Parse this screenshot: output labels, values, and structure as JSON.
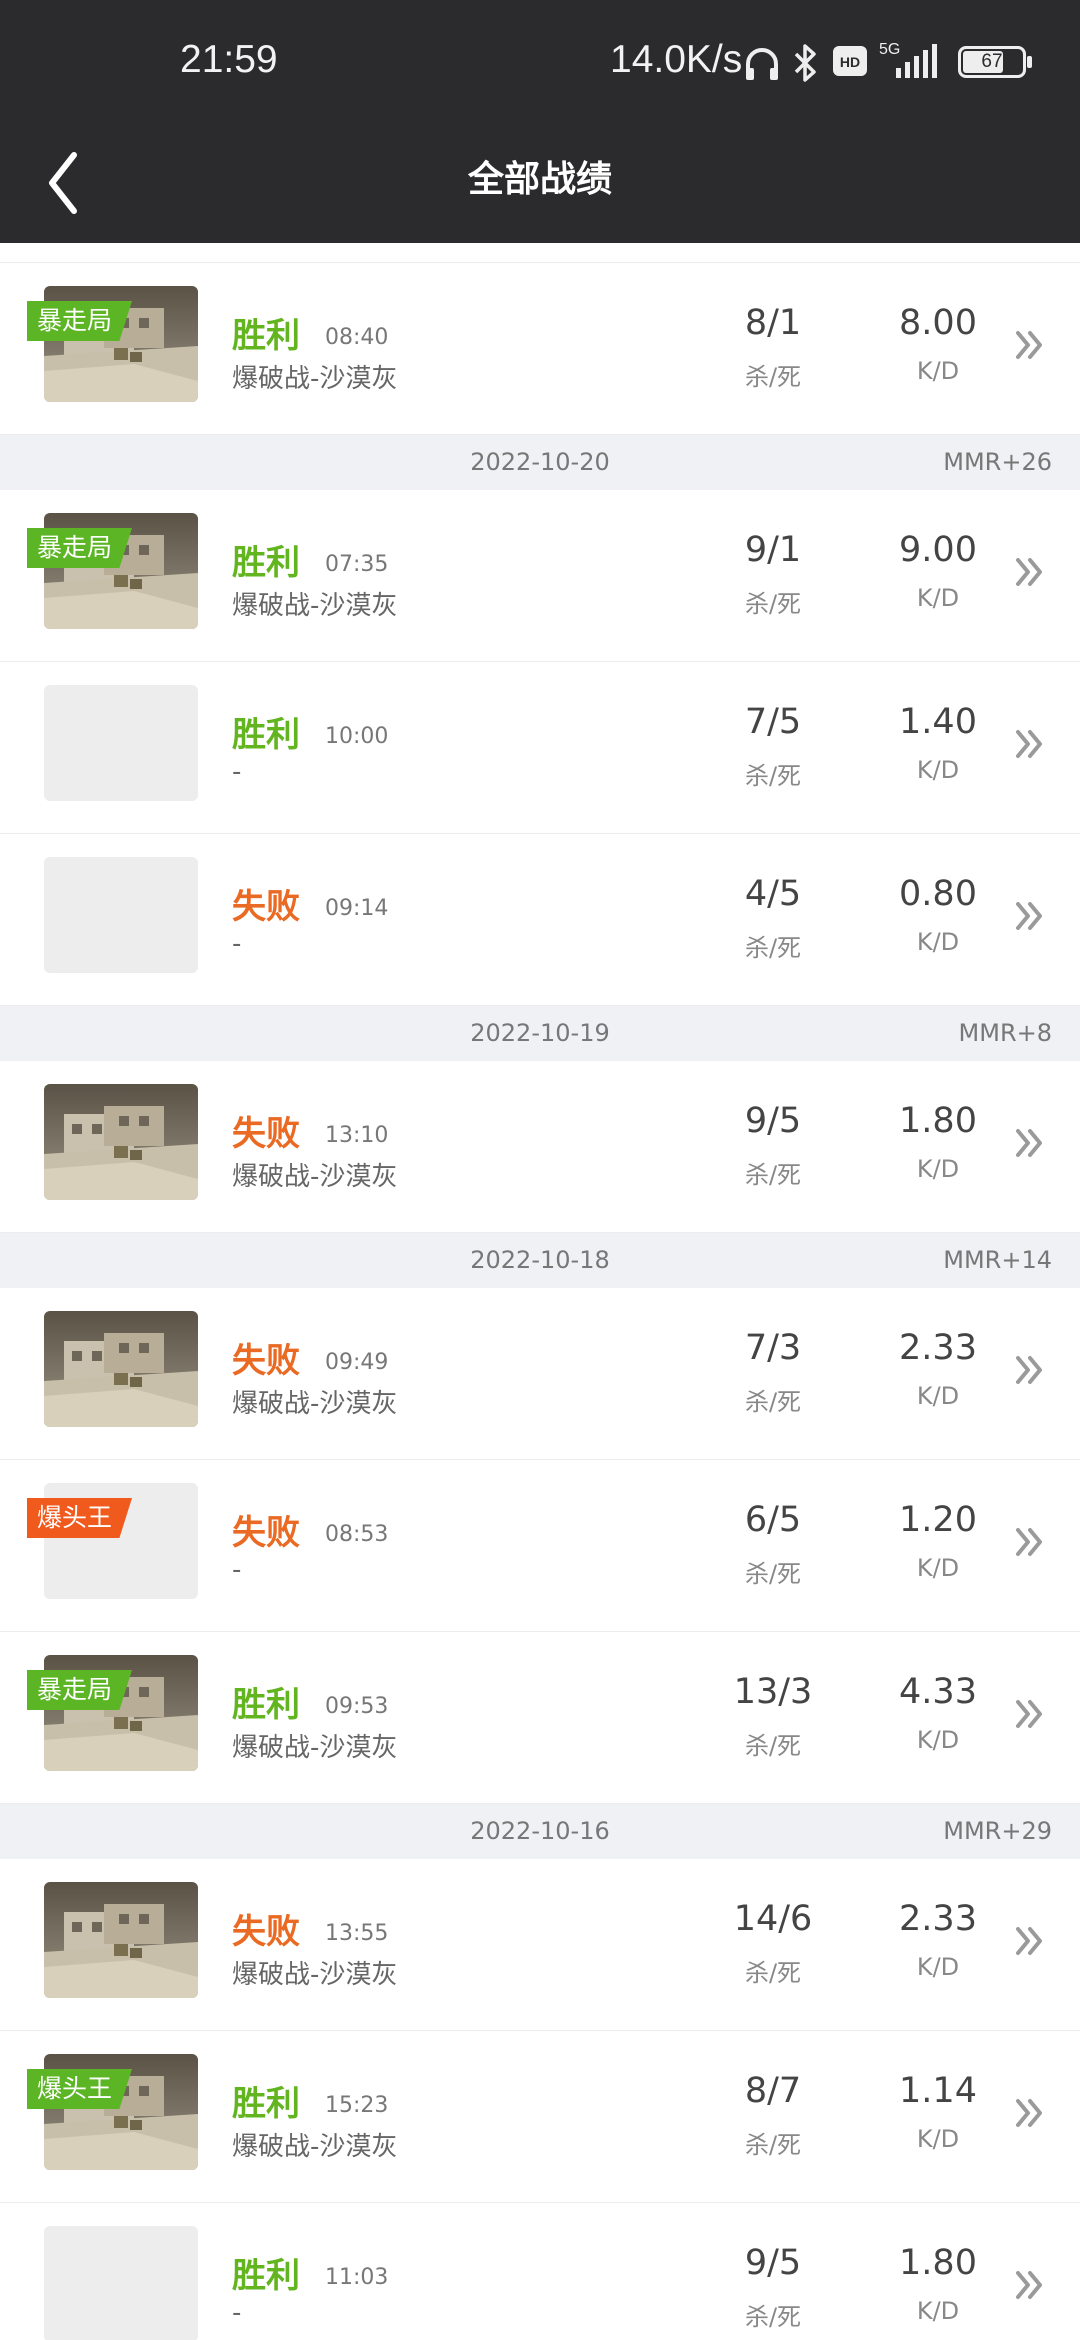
{
  "status_bar": {
    "time": "21:59",
    "network": "14.0K/s",
    "battery": "67",
    "icons": [
      "headphones-icon",
      "bluetooth-icon",
      "hd-icon",
      "signal-5g-icon",
      "battery-icon"
    ]
  },
  "header": {
    "title": "全部战绩",
    "back_icon": "back-arrow-icon"
  },
  "labels": {
    "kd_label": "杀/死",
    "ratio_label": "K/D"
  },
  "colors": {
    "win": "#62b51f",
    "lose": "#ea6a23",
    "badge_green": "#5cb525",
    "badge_orange": "#f05a1d",
    "header_bg": "#2b2b2d"
  },
  "items": [
    {
      "type": "match",
      "result": "胜利",
      "outcome": "win",
      "time": "08:40",
      "mode": "爆破战-沙漠灰",
      "kills": "8/1",
      "kd": "8.00",
      "map": true,
      "badge": "暴走局",
      "badge_color": "green"
    },
    {
      "type": "date",
      "date": "2022-10-20",
      "mmr": "MMR+26"
    },
    {
      "type": "match",
      "result": "胜利",
      "outcome": "win",
      "time": "07:35",
      "mode": "爆破战-沙漠灰",
      "kills": "9/1",
      "kd": "9.00",
      "map": true,
      "badge": "暴走局",
      "badge_color": "green"
    },
    {
      "type": "match",
      "result": "胜利",
      "outcome": "win",
      "time": "10:00",
      "mode": "-",
      "kills": "7/5",
      "kd": "1.40",
      "map": false,
      "badge": ""
    },
    {
      "type": "match",
      "result": "失败",
      "outcome": "lose",
      "time": "09:14",
      "mode": "-",
      "kills": "4/5",
      "kd": "0.80",
      "map": false,
      "badge": ""
    },
    {
      "type": "date",
      "date": "2022-10-19",
      "mmr": "MMR+8"
    },
    {
      "type": "match",
      "result": "失败",
      "outcome": "lose",
      "time": "13:10",
      "mode": "爆破战-沙漠灰",
      "kills": "9/5",
      "kd": "1.80",
      "map": true,
      "badge": ""
    },
    {
      "type": "date",
      "date": "2022-10-18",
      "mmr": "MMR+14"
    },
    {
      "type": "match",
      "result": "失败",
      "outcome": "lose",
      "time": "09:49",
      "mode": "爆破战-沙漠灰",
      "kills": "7/3",
      "kd": "2.33",
      "map": true,
      "badge": ""
    },
    {
      "type": "match",
      "result": "失败",
      "outcome": "lose",
      "time": "08:53",
      "mode": "-",
      "kills": "6/5",
      "kd": "1.20",
      "map": false,
      "badge": "爆头王",
      "badge_color": "orange"
    },
    {
      "type": "match",
      "result": "胜利",
      "outcome": "win",
      "time": "09:53",
      "mode": "爆破战-沙漠灰",
      "kills": "13/3",
      "kd": "4.33",
      "map": true,
      "badge": "暴走局",
      "badge_color": "green"
    },
    {
      "type": "date",
      "date": "2022-10-16",
      "mmr": "MMR+29"
    },
    {
      "type": "match",
      "result": "失败",
      "outcome": "lose",
      "time": "13:55",
      "mode": "爆破战-沙漠灰",
      "kills": "14/6",
      "kd": "2.33",
      "map": true,
      "badge": ""
    },
    {
      "type": "match",
      "result": "胜利",
      "outcome": "win",
      "time": "15:23",
      "mode": "爆破战-沙漠灰",
      "kills": "8/7",
      "kd": "1.14",
      "map": true,
      "badge": "爆头王",
      "badge_color": "green"
    },
    {
      "type": "match",
      "result": "胜利",
      "outcome": "win",
      "time": "11:03",
      "mode": "-",
      "kills": "9/5",
      "kd": "1.80",
      "map": false,
      "badge": ""
    }
  ]
}
